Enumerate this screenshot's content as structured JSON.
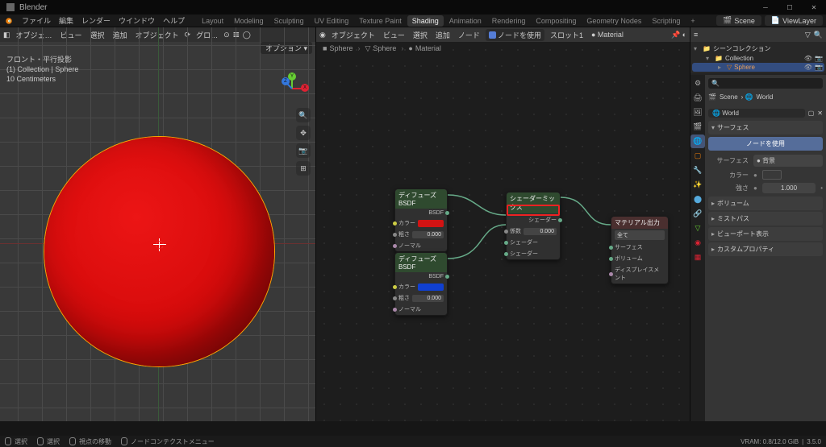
{
  "titlebar": {
    "title": "Blender"
  },
  "menubar": {
    "items": [
      "ファイル",
      "編集",
      "レンダー",
      "ウインドウ",
      "ヘルプ"
    ],
    "tabs": [
      "Layout",
      "Modeling",
      "Sculpting",
      "UV Editing",
      "Texture Paint",
      "Shading",
      "Animation",
      "Rendering",
      "Compositing",
      "Geometry Nodes",
      "Scripting"
    ],
    "active_tab": "Shading",
    "scene_label": "Scene",
    "viewlayer_label": "ViewLayer"
  },
  "vp_header": {
    "mode": "オブジェ…",
    "menus": [
      "ビュー",
      "選択",
      "追加",
      "オブジェクト"
    ],
    "global": "グロ…",
    "options": "オプション"
  },
  "viewport_overlay": {
    "line1": "フロント・平行投影",
    "line2": "(1) Collection | Sphere",
    "line3": "10 Centimeters"
  },
  "ne_header": {
    "type": "オブジェクト",
    "menus": [
      "ビュー",
      "選択",
      "追加",
      "ノード"
    ],
    "use_nodes": "ノードを使用",
    "slot": "スロット1",
    "material": "Material"
  },
  "breadcrumb": {
    "a": "Sphere",
    "b": "Sphere",
    "c": "Material"
  },
  "nodes": {
    "n1": {
      "title": "ディフューズBSDF",
      "out": "BSDF",
      "color": "カラー",
      "rough": "粗さ",
      "rough_val": "0.000",
      "normal": "ノーマル",
      "swatch": "#d21313"
    },
    "n2": {
      "title": "ディフューズBSDF",
      "out": "BSDF",
      "color": "カラー",
      "rough": "粗さ",
      "rough_val": "0.000",
      "normal": "ノーマル",
      "swatch": "#1040d2"
    },
    "mix": {
      "title": "シェーダーミックス",
      "out": "シェーダー",
      "fac": "係数",
      "fac_val": "0.000",
      "shader": "シェーダー"
    },
    "out": {
      "title": "マテリアル出力",
      "surface": "サーフェス",
      "volume": "ボリューム",
      "disp": "ディスプレイスメント",
      "target": "全て"
    }
  },
  "outliner": {
    "title": "シーンコレクション",
    "collection": "Collection",
    "sphere": "Sphere"
  },
  "props": {
    "scene_bc": [
      "Scene",
      "World"
    ],
    "world": "World",
    "surface_h": "サーフェス",
    "use_nodes": "ノードを使用",
    "surface_label": "サーフェス",
    "bg": "背景",
    "color_label": "カラー",
    "strength_label": "強さ",
    "strength_val": "1.000",
    "volume_h": "ボリューム",
    "mist_h": "ミストパス",
    "viewport_h": "ビューポート表示",
    "custom_h": "カスタムプロパティ"
  },
  "statusbar": {
    "a": "選択",
    "b": "選択",
    "c": "視点の移動",
    "d": "ノードコンテクストメニュー",
    "vram": "VRAM: 0.8/12.0 GiB",
    "ver": "3.5.0"
  }
}
